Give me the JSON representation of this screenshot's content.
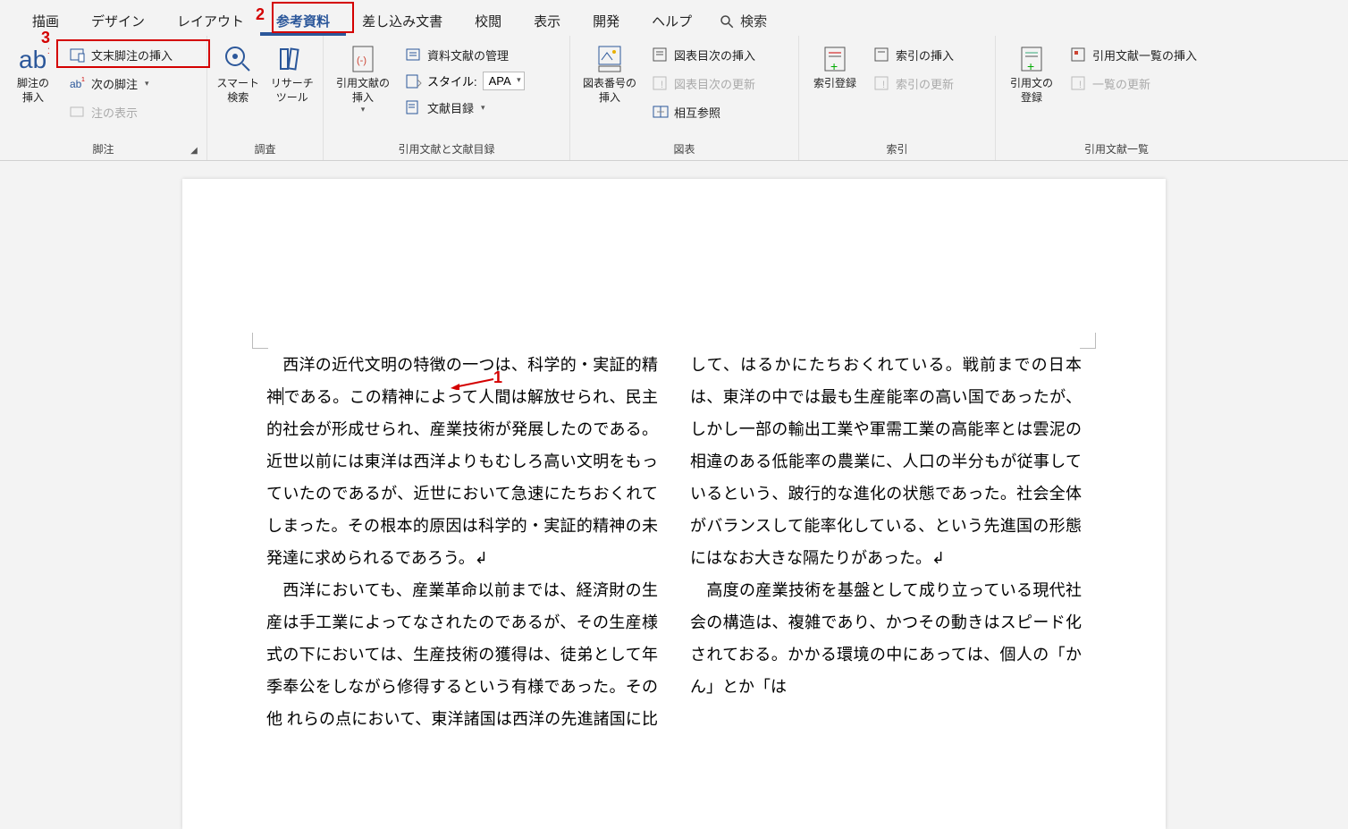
{
  "tabs": [
    "描画",
    "デザイン",
    "レイアウト",
    "参考資料",
    "差し込み文書",
    "校閲",
    "表示",
    "開発",
    "ヘルプ"
  ],
  "active_tab_index": 3,
  "search_placeholder": "検索",
  "annotations": {
    "1": "1",
    "2": "2",
    "3": "3"
  },
  "ribbon": {
    "footnote": {
      "big_label": "脚注の\n挿入",
      "insert_endnote": "文末脚注の挿入",
      "next_footnote": "次の脚注",
      "show_notes": "注の表示",
      "group_label": "脚注"
    },
    "research": {
      "smart": "スマート\n検索",
      "tool": "リサーチ\nツール",
      "group_label": "調査"
    },
    "citation": {
      "big_label": "引用文献の\n挿入",
      "manage": "資料文献の管理",
      "style_label": "スタイル:",
      "style_value": "APA",
      "biblio": "文献目録",
      "group_label": "引用文献と文献目録"
    },
    "caption": {
      "big_label": "図表番号の\n挿入",
      "insert_tof": "図表目次の挿入",
      "update_tof": "図表目次の更新",
      "crossref": "相互参照",
      "group_label": "図表"
    },
    "index": {
      "big_label": "索引登録",
      "insert_index": "索引の挿入",
      "update_index": "索引の更新",
      "group_label": "索引"
    },
    "toa": {
      "big_label": "引用文の\n登録",
      "insert_toa": "引用文献一覧の挿入",
      "update_toa": "一覧の更新",
      "group_label": "引用文献一覧"
    }
  },
  "document": {
    "p1": "　西洋の近代文明の特徴の一つは、科学的・実証的精神",
    "p1b": "である。この精神によって人間は解放せられ、民主的社会が形成せられ、産業技術が発展したのである。近世以前には東洋は西洋よりもむしろ高い文明をもっていたのであるが、近世において急速にたちおくれてしまった。その根本的原因は科学的・実証的精神の未発達に求められるであろう。↲",
    "p2": "　西洋においても、産業革命以前までは、経済財の生産は手工業によってなされたのであるが、その生産様式の下においては、生産技術の獲得は、徒弟として年季奉公をしながら修得するという有様であった。その他",
    "p3": "れらの点において、東洋諸国は西洋の先進諸国に比して、はるかにたちおくれている。戦前までの日本は、東洋の中では最も生産能率の高い国であったが、しかし一部の輸出工業や軍需工業の高能率とは雲泥の相違のある低能率の農業に、人口の半分もが従事しているという、跛行的な進化の状態であった。社会全体がバランスして能率化している、という先進国の形態にはなお大きな隔たりがあった。↲",
    "p4": "　高度の産業技術を基盤として成り立っている現代社会の構造は、複雑であり、かつその動きはスピード化されておる。かかる環境の中にあっては、個人の「かん」とか「は"
  }
}
